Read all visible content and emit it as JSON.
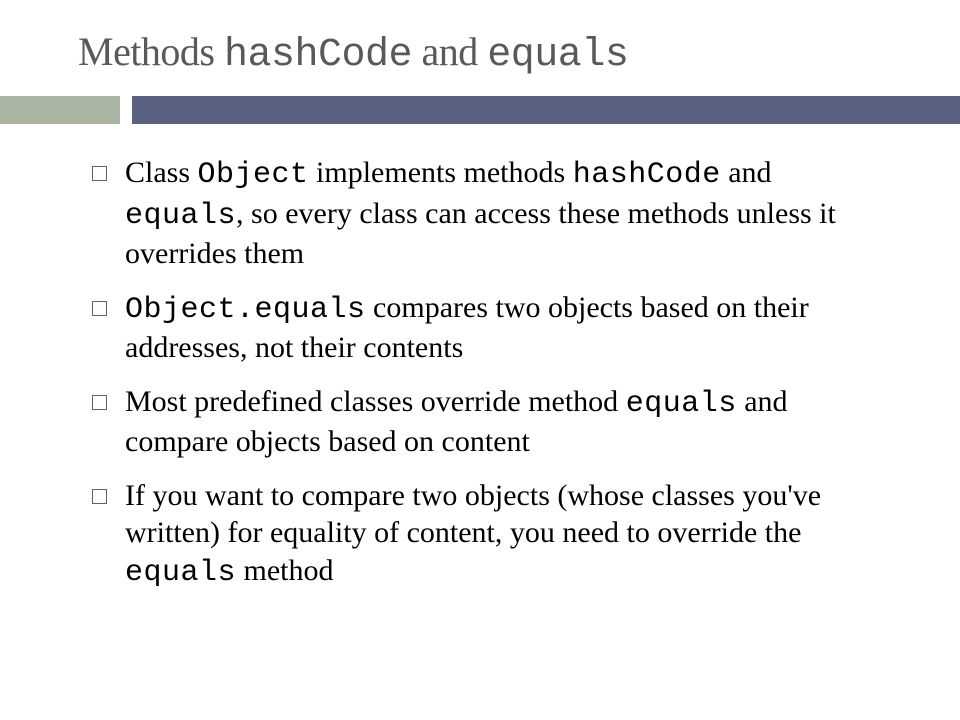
{
  "title": {
    "prefix": "Methods ",
    "code1": "hashCode",
    "mid": " and ",
    "code2": "equals"
  },
  "bullets": [
    {
      "segments": [
        {
          "t": "Class ",
          "c": false
        },
        {
          "t": "Object",
          "c": true
        },
        {
          "t": " implements methods ",
          "c": false
        },
        {
          "t": "hashCode",
          "c": true
        },
        {
          "t": " and ",
          "c": false
        },
        {
          "t": "equals",
          "c": true
        },
        {
          "t": ", so every class can access these methods unless it overrides them",
          "c": false
        }
      ]
    },
    {
      "segments": [
        {
          "t": "Object.equals",
          "c": true
        },
        {
          "t": " compares two objects based on their addresses, not their contents",
          "c": false
        }
      ]
    },
    {
      "segments": [
        {
          "t": "Most predefined classes override method ",
          "c": false
        },
        {
          "t": "equals",
          "c": true
        },
        {
          "t": " and compare objects based on content",
          "c": false
        }
      ]
    },
    {
      "segments": [
        {
          "t": "If you want to compare two objects (whose classes you've written) for equality of content, you need to override the ",
          "c": false
        },
        {
          "t": "equals",
          "c": true
        },
        {
          "t": " method",
          "c": false
        }
      ]
    }
  ]
}
